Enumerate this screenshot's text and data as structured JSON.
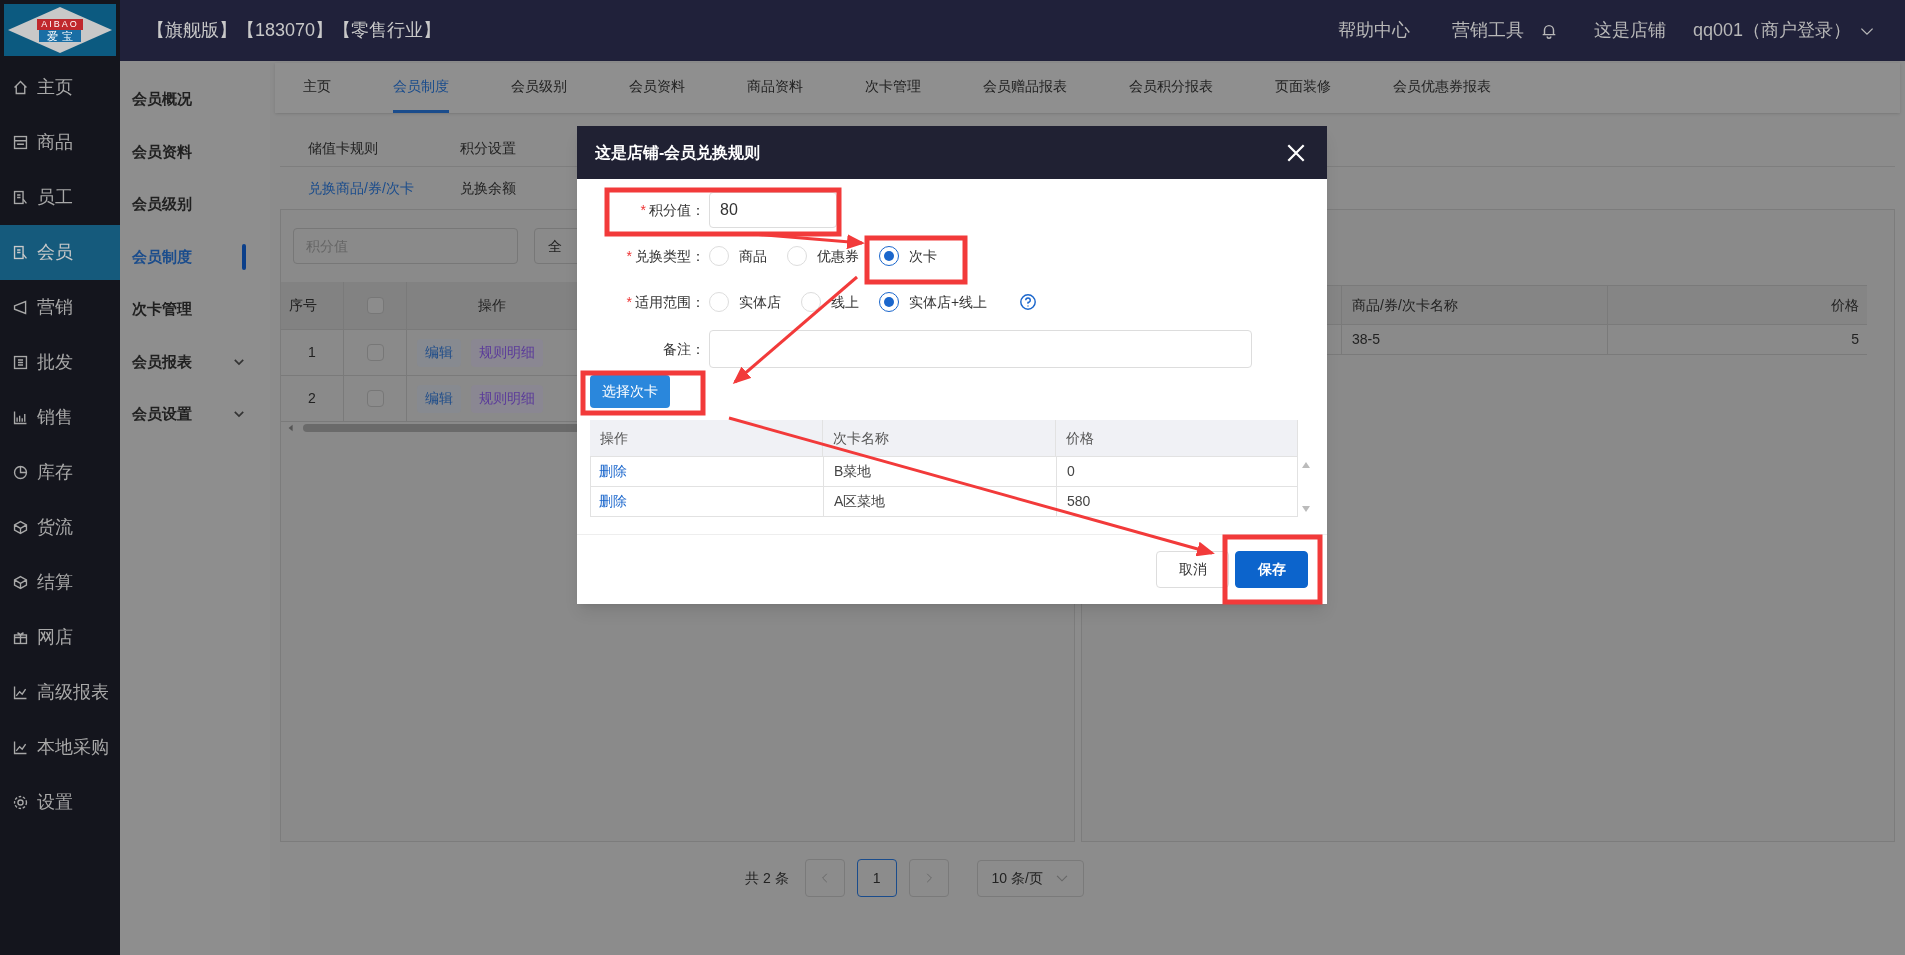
{
  "logo": {
    "text": "AIBAO",
    "subtext": "爱 宝"
  },
  "header": {
    "title": "【旗舰版】【183070】【零售行业】",
    "links": [
      "帮助中心",
      "营销工具"
    ],
    "shop": "这是店铺",
    "user": "qq001（商户登录）"
  },
  "nav": [
    {
      "label": "主页",
      "selected": false
    },
    {
      "label": "商品",
      "selected": false
    },
    {
      "label": "员工",
      "selected": false
    },
    {
      "label": "会员",
      "selected": true
    },
    {
      "label": "营销",
      "selected": false
    },
    {
      "label": "批发",
      "selected": false
    },
    {
      "label": "销售",
      "selected": false
    },
    {
      "label": "库存",
      "selected": false
    },
    {
      "label": "货流",
      "selected": false
    },
    {
      "label": "结算",
      "selected": false
    },
    {
      "label": "网店",
      "selected": false
    },
    {
      "label": "高级报表",
      "selected": false
    },
    {
      "label": "本地采购",
      "selected": false
    },
    {
      "label": "设置",
      "selected": false
    }
  ],
  "subnav": [
    {
      "label": "会员概况",
      "selected": false,
      "expandable": false
    },
    {
      "label": "会员资料",
      "selected": false,
      "expandable": false
    },
    {
      "label": "会员级别",
      "selected": false,
      "expandable": false
    },
    {
      "label": "会员制度",
      "selected": true,
      "expandable": false
    },
    {
      "label": "次卡管理",
      "selected": false,
      "expandable": false
    },
    {
      "label": "会员报表",
      "selected": false,
      "expandable": true
    },
    {
      "label": "会员设置",
      "selected": false,
      "expandable": true
    }
  ],
  "tabs": [
    {
      "label": "主页",
      "selected": false
    },
    {
      "label": "会员制度",
      "selected": true
    },
    {
      "label": "会员级别",
      "selected": false
    },
    {
      "label": "会员资料",
      "selected": false
    },
    {
      "label": "商品资料",
      "selected": false
    },
    {
      "label": "次卡管理",
      "selected": false
    },
    {
      "label": "会员赠品报表",
      "selected": false
    },
    {
      "label": "会员积分报表",
      "selected": false
    },
    {
      "label": "页面装修",
      "selected": false
    },
    {
      "label": "会员优惠券报表",
      "selected": false
    }
  ],
  "subtabs": [
    {
      "label": "储值卡规则",
      "selected": false
    },
    {
      "label": "积分设置",
      "selected": false
    }
  ],
  "subtabs_2": [
    {
      "label": "兑换商品/券/次卡",
      "selected": true
    },
    {
      "label": "兑换余额",
      "selected": false
    }
  ],
  "filter": {
    "placeholder": "积分值",
    "button": "全"
  },
  "left_table": {
    "columns": [
      "序号",
      "操作"
    ],
    "header_checked": false,
    "rows": [
      {
        "index": "1",
        "checked": false,
        "actions": [
          "编辑",
          "规则明细"
        ]
      },
      {
        "index": "2",
        "checked": false,
        "actions": [
          "编辑",
          "规则明细"
        ]
      }
    ]
  },
  "right_table": {
    "columns": [
      "商品/券/次卡名称",
      "价格"
    ],
    "rows": [
      {
        "name": "38-5",
        "price": "5"
      }
    ]
  },
  "pagination": {
    "total": "共 2 条",
    "pages": [
      {
        "label": "1",
        "selected": true
      }
    ],
    "page_size": "10 条/页"
  },
  "dialog": {
    "title": "这是店铺-会员兑换规则",
    "fields": [
      {
        "kind": "input",
        "label": "积分值：",
        "marker": "*",
        "value": "80"
      },
      {
        "kind": "radio",
        "label": "兑换类型：",
        "marker": "*",
        "options": [
          {
            "label": "商品",
            "selected": false
          },
          {
            "label": "优惠券",
            "selected": false
          },
          {
            "label": "次卡",
            "selected": true
          }
        ]
      },
      {
        "kind": "radio",
        "label": "适用范围：",
        "marker": "*",
        "help": true,
        "options": [
          {
            "label": "实体店",
            "selected": false
          },
          {
            "label": "线上",
            "selected": false
          },
          {
            "label": "实体店+线上",
            "selected": true
          }
        ]
      },
      {
        "kind": "wide_input",
        "label": "备注："
      }
    ],
    "select_button": "选择次卡",
    "table": {
      "columns": [
        "操作",
        "次卡名称",
        "价格"
      ],
      "rows": [
        {
          "action": "删除",
          "name": "B菜地",
          "price": "0"
        },
        {
          "action": "删除",
          "name": "A区菜地",
          "price": "580"
        }
      ]
    },
    "buttons": [
      {
        "label": "取消",
        "kind": "secondary"
      },
      {
        "label": "保存",
        "kind": "primary"
      }
    ]
  }
}
